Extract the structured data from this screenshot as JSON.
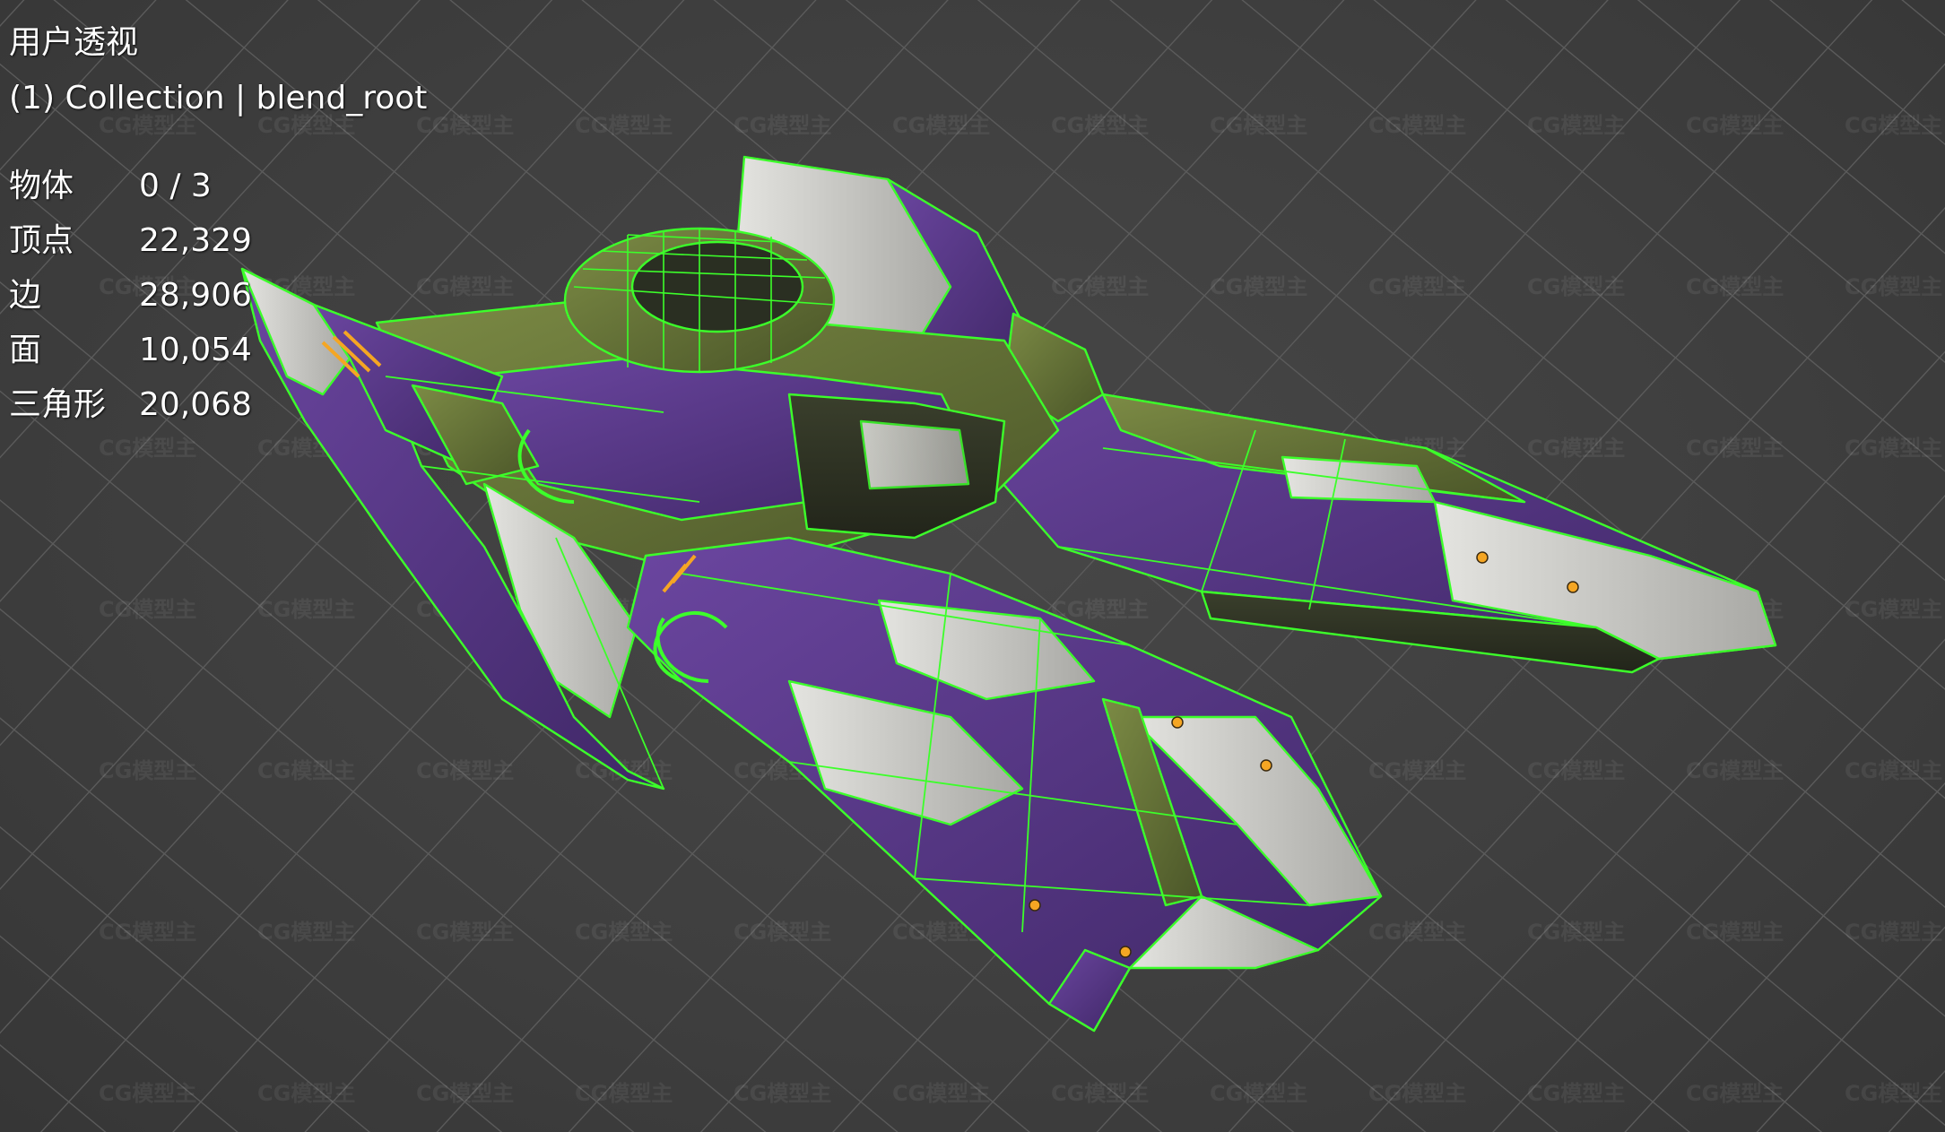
{
  "viewport": {
    "view_mode": "用户透视",
    "collection": "(1) Collection | blend_root"
  },
  "stats": [
    {
      "label": "物体",
      "value": "0 / 3"
    },
    {
      "label": "顶点",
      "value": "22,329"
    },
    {
      "label": "边",
      "value": "28,906"
    },
    {
      "label": "面",
      "value": "10,054"
    },
    {
      "label": "三角形",
      "value": "20,068"
    }
  ],
  "watermark": {
    "text": "CG模型主"
  },
  "colors": {
    "background": "#3d3d3d",
    "grid": "#5a5a5a",
    "wireframe": "#3cff2a",
    "hull_purple": "#5a3a86",
    "hull_green": "#6a7a3a",
    "hull_white": "#d6d6d2",
    "accent_orange": "#f5a623"
  }
}
